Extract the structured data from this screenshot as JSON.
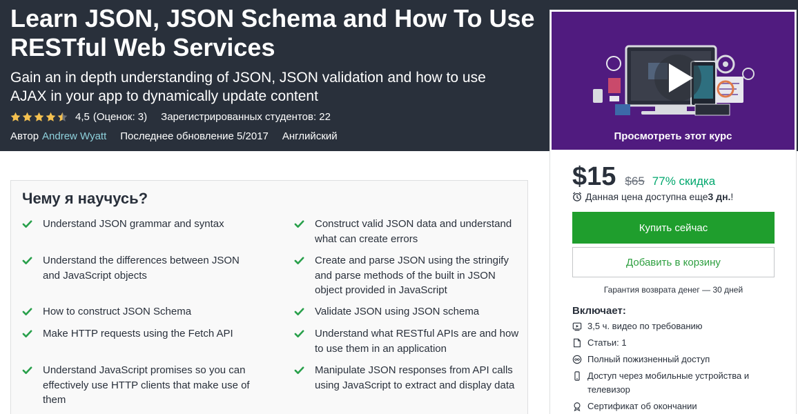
{
  "header": {
    "title": "Learn JSON, JSON Schema and How To Use RESTful Web Services",
    "subtitle": "Gain an in depth understanding of JSON, JSON validation and how to use AJAX in your app to dynamically update content",
    "rating": {
      "stars": 4.5,
      "value": "4,5",
      "count_label": "(Оценок: 3)",
      "students_label": "Зарегистрированных студентов: 22"
    },
    "author_prefix": "Автор",
    "author_name": "Andrew Wyatt",
    "last_updated": "Последнее обновление 5/2017",
    "language": "Английский"
  },
  "learn": {
    "title": "Чему я научусь?",
    "items": [
      "Understand JSON grammar and syntax",
      "Construct valid JSON data and understand what can create errors",
      "Understand the differences between JSON and JavaScript objects",
      "Create and parse JSON using the stringify and parse methods of the built in JSON object provided in JavaScript",
      "How to construct JSON Schema",
      "Validate JSON using JSON schema",
      "Make HTTP requests using the Fetch API",
      "Understand what RESTful APIs are and how to use them in an application",
      "Understand JavaScript promises so you can effectively use HTTP clients that make use of them",
      "Manipulate JSON responses from API calls using JavaScript to extract and display data"
    ]
  },
  "sidebar": {
    "preview_label": "Просмотреть этот курс",
    "price": "$15",
    "old_price": "$65",
    "discount": "77% скидка",
    "deadline_text": "Данная цена доступна еще ",
    "deadline_days": "3 дн.",
    "deadline_suffix": "!",
    "buy_label": "Купить сейчас",
    "cart_label": "Добавить в корзину",
    "guarantee": "Гарантия возврата денег — 30 дней",
    "includes_title": "Включает:",
    "includes": [
      {
        "icon": "video-icon",
        "text": "3,5 ч. видео по требованию"
      },
      {
        "icon": "article-icon",
        "text": "Статьи: 1"
      },
      {
        "icon": "infinity-icon",
        "text": "Полный пожизненный доступ"
      },
      {
        "icon": "mobile-icon",
        "text": "Доступ через мобильные устройства и телевизор"
      },
      {
        "icon": "certificate-icon",
        "text": "Сертификат об окончании"
      }
    ]
  },
  "colors": {
    "hero_bg": "#29303b",
    "accent_green": "#1f9e2d",
    "discount_green": "#00a76d",
    "star_yellow": "#f4c150",
    "check_green": "#29a04b",
    "link_blue": "#8ed1dc",
    "preview_purple": "#5b1f8c"
  }
}
